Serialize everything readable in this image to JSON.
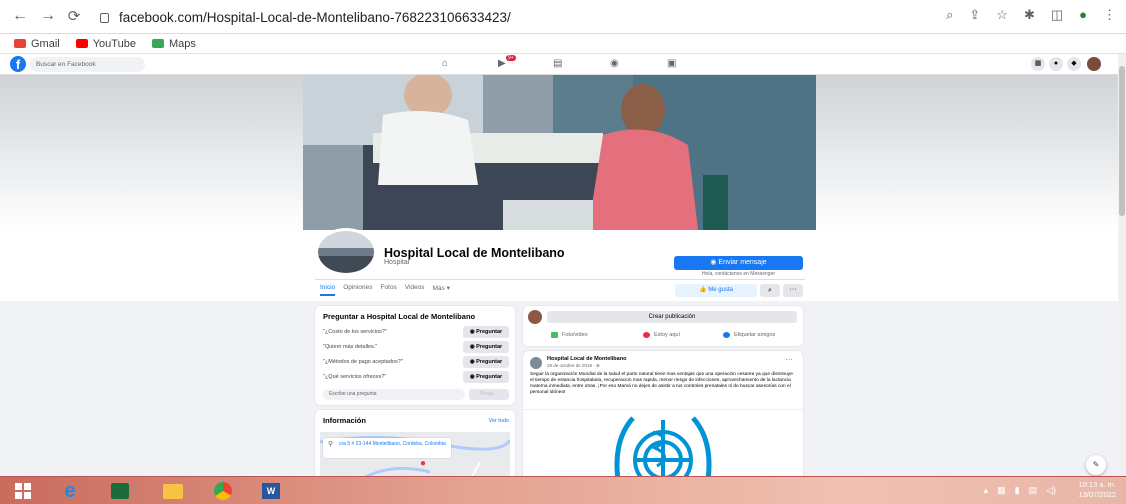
{
  "browser": {
    "url": "facebook.com/Hospital-Local-de-Montelibano-768223106633423/",
    "bookmarks": [
      "Gmail",
      "YouTube",
      "Maps"
    ]
  },
  "fb": {
    "search_placeholder": "Buscar en Facebook",
    "notification_count": "9+"
  },
  "page": {
    "name": "Hospital Local de Montelibano",
    "category": "Hospital",
    "message_button": "Enviar mensaje",
    "message_sub": "Hola, contáctenos en Messenger",
    "tabs": [
      "Inicio",
      "Opiniones",
      "Fotos",
      "Videos",
      "Más ▾"
    ],
    "like_button": "Me gusta",
    "more_button": "···"
  },
  "ask": {
    "title": "Preguntar a Hospital Local de Montelibano",
    "questions": [
      "\"¿Costo de los servicios?\"",
      "\"Quiero más detalles.\"",
      "\"¿Métodos de pago aceptados?\"",
      "\"¿Qué servicios ofreces?\""
    ],
    "ask_button": "Preguntar",
    "input_placeholder": "Escribe una pregunta",
    "send_button": "Pregu..."
  },
  "info": {
    "title": "Información",
    "see_all": "Ver todo",
    "address": "cra 5 # 23-144 Montelibano, Cordoba, Colombia"
  },
  "create_post": {
    "title": "Crear publicación",
    "actions": [
      "Foto/video",
      "Estoy aquí",
      "Etiquetar amigos"
    ]
  },
  "post": {
    "author": "Hospital Local de Montelibano",
    "date": "28 de octubre de 2019 · ⊕",
    "text": "Seguir la organización Mundial de la salud el parto natural tiene mas ventajas que una operación cesarea ya que disminuye el tiempo de estancia hospitalaria, recuperacion mas rapida, menor riesgo de infecciones, aprovechamiento de la lactancia materna inmediata, entre otras. ¡Por eso Mamá no dejes de asistir a tus controles prenatales ni de buscar asesorías con el personal idóneo!"
  },
  "taskbar": {
    "time": "10:13 a. m.",
    "date": "13/07/2022"
  },
  "colors": {
    "fb_blue": "#1877f2",
    "taskbar": "#e3a08f"
  }
}
